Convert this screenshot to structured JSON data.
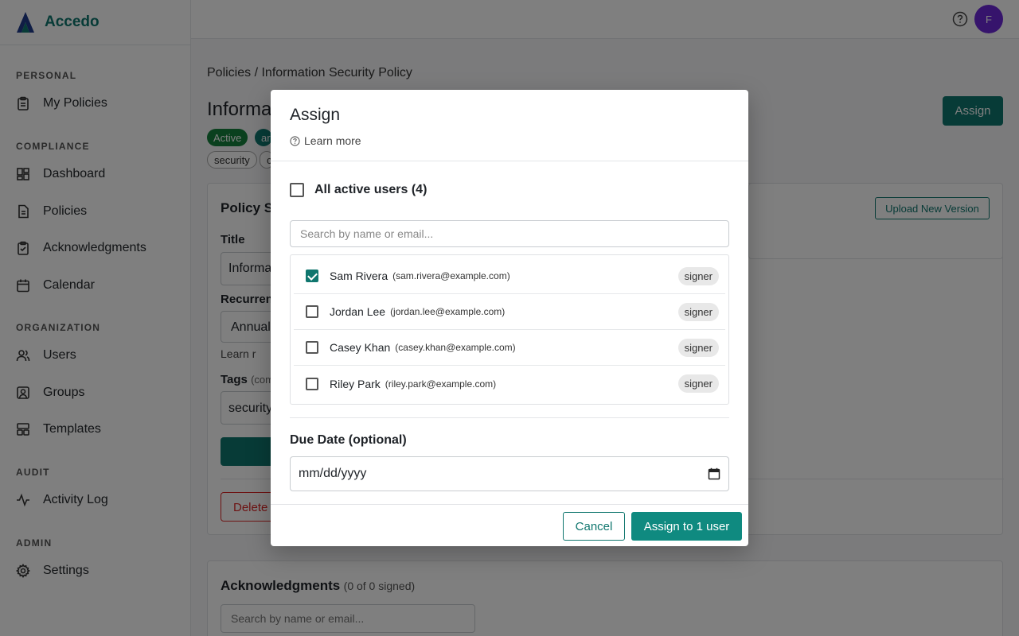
{
  "brand": {
    "name": "Accedo"
  },
  "topbar": {
    "avatar_initial": "F"
  },
  "sidebar": {
    "sections": [
      {
        "label": "PERSONAL"
      },
      {
        "label": "COMPLIANCE"
      },
      {
        "label": "ORGANIZATION"
      },
      {
        "label": "AUDIT"
      },
      {
        "label": "ADMIN"
      }
    ],
    "items": [
      {
        "label": "My Policies",
        "icon": "clipboard-icon"
      },
      {
        "label": "Dashboard",
        "icon": "dashboard-icon"
      },
      {
        "label": "Policies",
        "icon": "document-icon"
      },
      {
        "label": "Acknowledgments",
        "icon": "clipboard-check-icon"
      },
      {
        "label": "Calendar",
        "icon": "calendar-icon"
      },
      {
        "label": "Users",
        "icon": "users-icon"
      },
      {
        "label": "Groups",
        "icon": "group-icon"
      },
      {
        "label": "Templates",
        "icon": "template-icon"
      },
      {
        "label": "Activity Log",
        "icon": "activity-icon"
      },
      {
        "label": "Settings",
        "icon": "gear-icon"
      }
    ]
  },
  "page": {
    "breadcrumb": "Policies / Information Security Policy",
    "title": "Informa",
    "assign_label": "Assign",
    "status_badge": "Active",
    "badge_partial": "ar",
    "tag_security": "security",
    "tag_partial": "c",
    "policy_section_title": "Policy S",
    "title_label": "Title",
    "title_value": "Informa",
    "recurrence_label": "Recurren",
    "recurrence_value": "Annual",
    "learn_partial": "Learn r",
    "tags_label": "Tags",
    "tags_hint": "(com",
    "tags_value": "security",
    "delete_label": "Delete",
    "upload_label": "Upload New Version",
    "ack_title": "Acknowledgments",
    "ack_count": "(0 of 0 signed)",
    "ack_search_placeholder": "Search by name or email..."
  },
  "modal": {
    "title": "Assign",
    "learn_more": "Learn more",
    "all_users_label": "All active users (4)",
    "search_placeholder": "Search by name or email...",
    "users": [
      {
        "name": "Sam Rivera",
        "email": "(sam.rivera@example.com)",
        "role": "signer",
        "checked": true
      },
      {
        "name": "Jordan Lee",
        "email": "(jordan.lee@example.com)",
        "role": "signer",
        "checked": false
      },
      {
        "name": "Casey Khan",
        "email": "(casey.khan@example.com)",
        "role": "signer",
        "checked": false
      },
      {
        "name": "Riley Park",
        "email": "(riley.park@example.com)",
        "role": "signer",
        "checked": false
      }
    ],
    "due_date_label": "Due Date (optional)",
    "due_date_placeholder": "mm/dd/yyyy",
    "cancel_label": "Cancel",
    "confirm_label": "Assign to 1 user"
  },
  "colors": {
    "accent": "#0f766e",
    "avatar": "#6d28d9"
  }
}
